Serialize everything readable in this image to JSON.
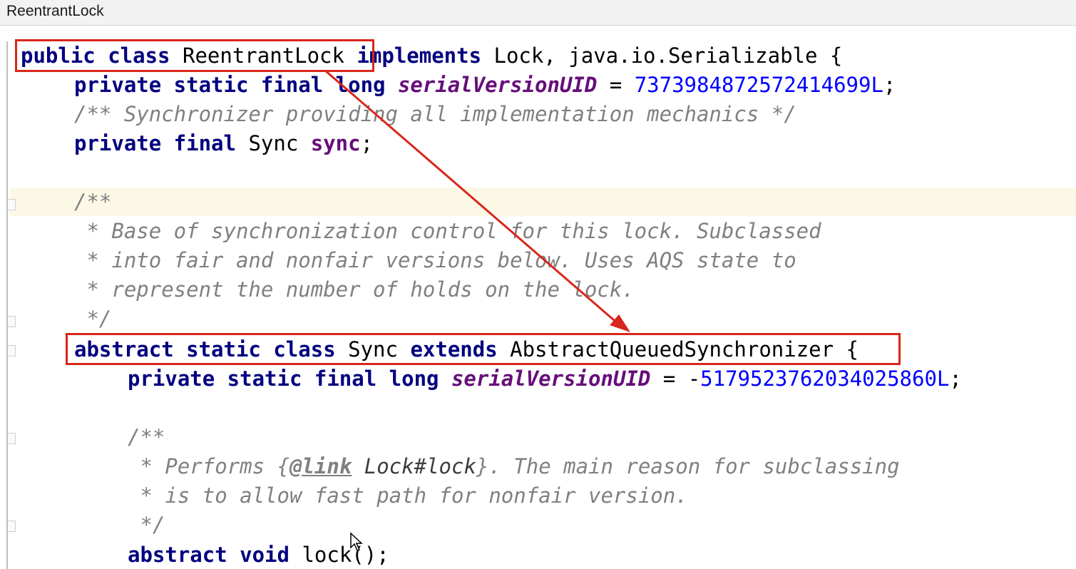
{
  "window": {
    "title": "ReentrantLock"
  },
  "code": {
    "line1": {
      "kw": "public class",
      "name": "ReentrantLock",
      "kw2": "implements",
      "rest": "Lock, java.io.Serializable {"
    },
    "line2": {
      "kw": "private static final long",
      "field": "serialVersionUID",
      "eq": " = ",
      "num": "7373984872572414699L",
      "end": ";"
    },
    "line3": {
      "comment": "/** Synchronizer providing all implementation mechanics */"
    },
    "line4": {
      "kw": "private final",
      "type": "Sync",
      "var": "sync",
      "end": ";"
    },
    "line6": {
      "comment": "/**"
    },
    "line7": {
      "comment": " * Base of synchronization control for this lock. Subclassed"
    },
    "line8": {
      "comment": " * into fair and nonfair versions below. Uses AQS state to"
    },
    "line9": {
      "comment": " * represent the number of holds on the lock."
    },
    "line10": {
      "comment": " */"
    },
    "line11": {
      "kw": "abstract static class",
      "name": "Sync",
      "kw2": "extends",
      "super": "AbstractQueuedSynchronizer",
      "end": " {"
    },
    "line12": {
      "kw": "private static final long",
      "field": "serialVersionUID",
      "eq": " = -",
      "num": "5179523762034025860L",
      "end": ";"
    },
    "line14": {
      "comment": "/**"
    },
    "line15": {
      "c1": " * Performs {",
      "tag": "@link",
      "ref": "Lock#lock",
      "c2": "}. The main reason for subclassing"
    },
    "line16": {
      "comment": " * is to allow fast path for nonfair version."
    },
    "line17": {
      "comment": " */"
    },
    "line18": {
      "kw": "abstract void",
      "rest": "lock();"
    }
  },
  "annotations": {
    "color": "#d9261c"
  }
}
